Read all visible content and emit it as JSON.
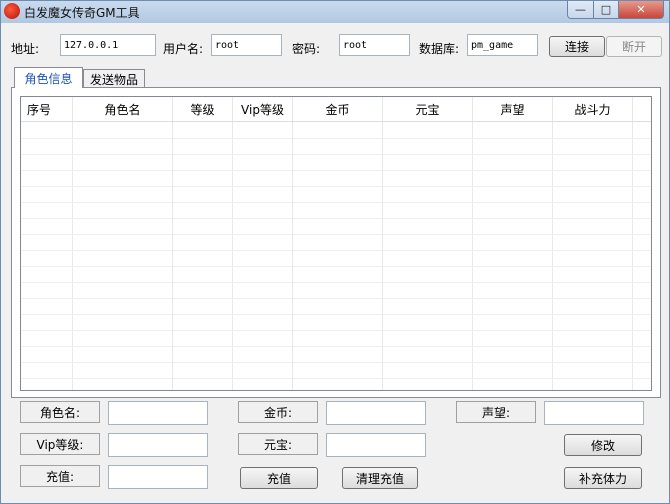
{
  "window": {
    "title": "白发魔女传奇GM工具",
    "controls": {
      "minimize": "—",
      "maximize": "□",
      "close": "✕"
    }
  },
  "connection": {
    "address_label": "地址:",
    "address_value": "127.0.0.1",
    "username_label": "用户名:",
    "username_value": "root",
    "password_label": "密码:",
    "password_value": "root",
    "database_label": "数据库:",
    "database_value": "pm_game",
    "connect_button": "连接",
    "disconnect_button": "断开"
  },
  "tabs": [
    {
      "label": "角色信息",
      "active": true
    },
    {
      "label": "发送物品",
      "active": false
    }
  ],
  "table": {
    "columns": [
      "序号",
      "角色名",
      "等级",
      "Vip等级",
      "金币",
      "元宝",
      "声望",
      "战斗力"
    ],
    "rows": []
  },
  "form": {
    "role_name_label": "角色名:",
    "vip_level_label": "Vip等级:",
    "recharge_label": "充值:",
    "gold_label": "金币:",
    "yuanbao_label": "元宝:",
    "reputation_label": "声望:",
    "role_name_value": "",
    "vip_level_value": "",
    "recharge_value": "",
    "gold_value": "",
    "yuanbao_value": "",
    "reputation_value": "",
    "recharge_button": "充值",
    "clear_recharge_button": "清理充值",
    "modify_button": "修改",
    "replenish_stamina_button": "补充体力"
  },
  "colors": {
    "titlebar": "#c9dbee",
    "active_tab_text": "#1b54b3",
    "close_button": "#c9463a"
  }
}
